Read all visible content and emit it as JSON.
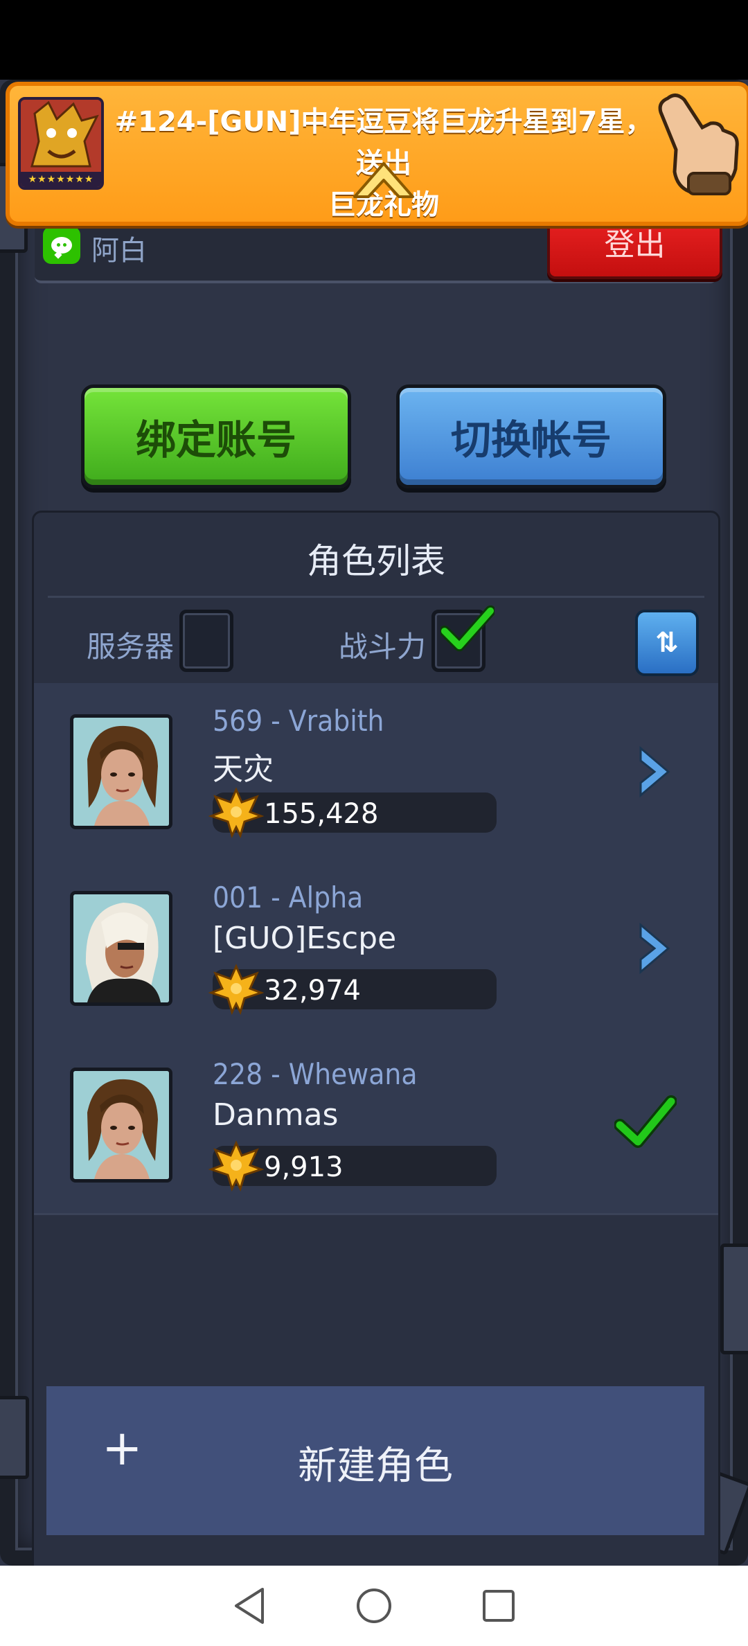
{
  "banner": {
    "message_line1": "#124-[GUN]中年逗豆将巨龙升星到7星，送出",
    "message_line2": "巨龙礼物",
    "stars": "★★★★★★★"
  },
  "account": {
    "name": "阿白",
    "logout_label": "登出"
  },
  "actions": {
    "bind_label": "绑定账号",
    "switch_label": "切换帐号"
  },
  "panel": {
    "title": "角色列表",
    "sort_server_label": "服务器",
    "sort_power_label": "战斗力",
    "sort_toggle_label": "⇅"
  },
  "characters": [
    {
      "server": "569 - Vrabith",
      "name": "天灾",
      "power": "155,428"
    },
    {
      "server": "001 - Alpha",
      "name": "[GUO]Escpe",
      "power": "32,974"
    },
    {
      "server": "228 - Whewana",
      "name": "Danmas",
      "power": "9,913"
    }
  ],
  "new_character": {
    "plus": "+",
    "label": "新建角色"
  },
  "colors": {
    "accent_green": "#3fab1c",
    "accent_blue": "#3d7fd1",
    "logout_red": "#d81818",
    "banner_orange": "#ff9c18",
    "check_green": "#22c81a"
  }
}
